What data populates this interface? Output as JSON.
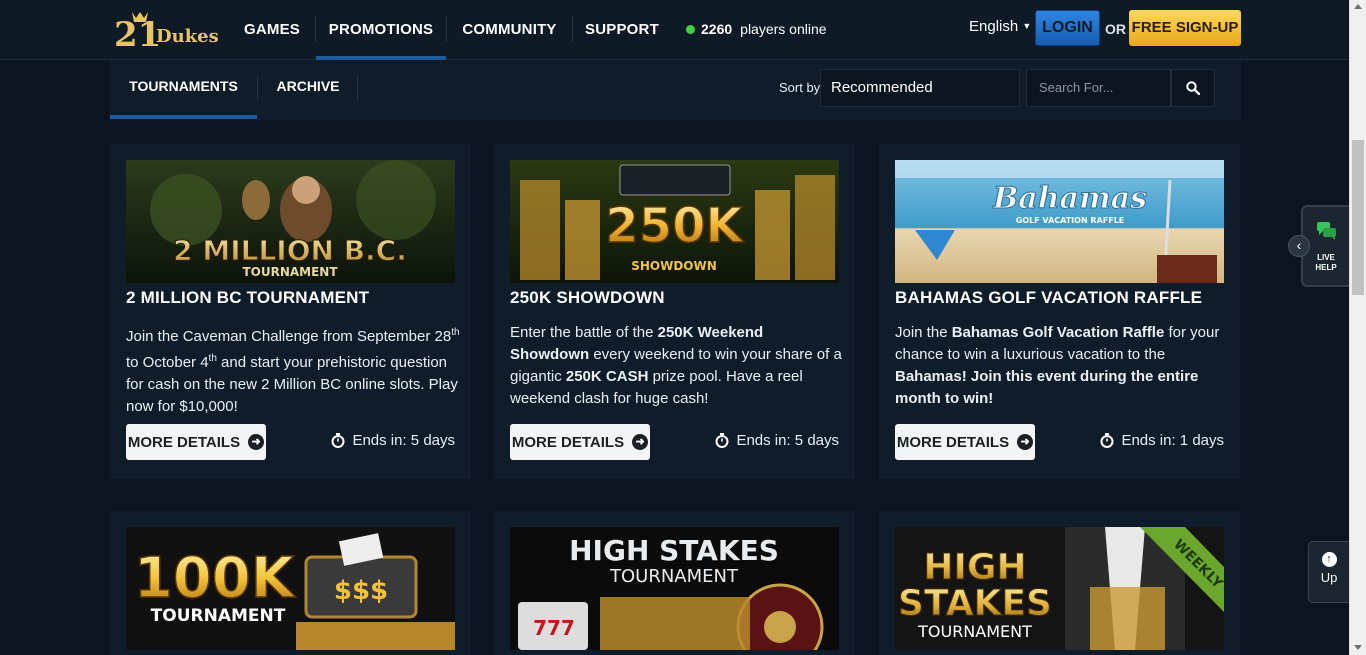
{
  "header": {
    "logo_text": "21 Dukes",
    "nav": [
      "GAMES",
      "PROMOTIONS",
      "COMMUNITY",
      "SUPPORT"
    ],
    "active_nav": "PROMOTIONS",
    "players_online_count": "2260",
    "players_online_label": "players online",
    "language": "English",
    "login_label": "LOGIN",
    "or_label": "OR",
    "signup_label": "FREE SIGN-UP"
  },
  "subnav": {
    "tabs": [
      "TOURNAMENTS",
      "ARCHIVE"
    ],
    "active_tab": "TOURNAMENTS",
    "sort_label": "Sort by",
    "sort_value": "Recommended",
    "search_placeholder": "Search For..."
  },
  "cards": [
    {
      "title": "2 MILLION BC TOURNAMENT",
      "image_text": [
        "2 MILLION B.C.",
        "TOURNAMENT"
      ],
      "desc": [
        {
          "t": "Join the Caveman Challenge from September 28",
          "b": false
        },
        {
          "t": "th",
          "b": false
        },
        {
          "t": " to October 4",
          "b": false
        },
        {
          "t": "th",
          "b": false
        },
        {
          "t": " and start your prehistoric question for cash on the new 2 Million BC online slots. Play now for $10,000!",
          "b": false
        }
      ],
      "button": "MORE DETAILS",
      "ends": "Ends in: 5 days"
    },
    {
      "title": "250K SHOWDOWN",
      "image_text": [
        "250K",
        "SHOWDOWN"
      ],
      "desc": [
        {
          "t": "Enter the battle of the ",
          "b": false
        },
        {
          "t": "250K Weekend Showdown",
          "b": true
        },
        {
          "t": " every weekend to win your share of a gigantic ",
          "b": false
        },
        {
          "t": "250K CASH",
          "b": true
        },
        {
          "t": " prize pool. Have a reel weekend clash for huge cash!",
          "b": false
        }
      ],
      "button": "MORE DETAILS",
      "ends": "Ends in: 5 days"
    },
    {
      "title": "BAHAMAS GOLF VACATION RAFFLE",
      "image_text": [
        "Bahamas",
        "GOLF VACATION RAFFLE"
      ],
      "desc": [
        {
          "t": "Join the ",
          "b": false
        },
        {
          "t": "Bahamas Golf Vacation Raffle",
          "b": true
        },
        {
          "t": " for your chance to win a luxurious vacation to the ",
          "b": false
        },
        {
          "t": "Bahamas! Join this event during the entire month to win!",
          "b": true
        }
      ],
      "button": "MORE DETAILS",
      "ends": "Ends in: 1 days"
    },
    {
      "image_text": [
        "100K",
        "TOURNAMENT"
      ]
    },
    {
      "image_text": [
        "HIGH STAKES",
        "TOURNAMENT"
      ]
    },
    {
      "image_text": [
        "HIGH",
        "STAKES",
        "TOURNAMENT",
        "WEEKLY"
      ]
    }
  ],
  "widgets": {
    "live_help": [
      "LIVE",
      "HELP"
    ],
    "up_label": "Up"
  }
}
